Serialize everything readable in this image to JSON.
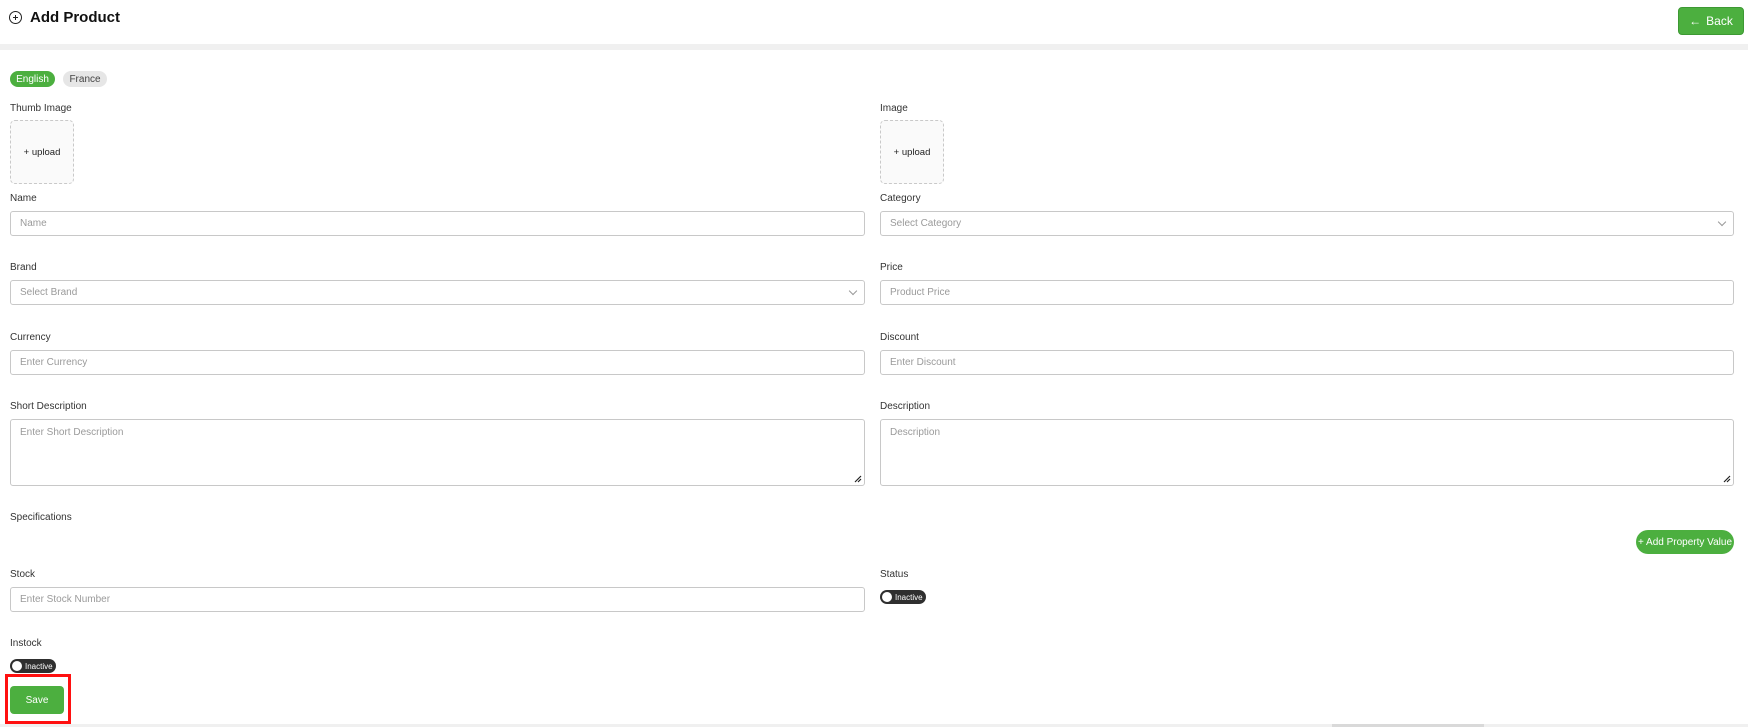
{
  "header": {
    "title": "Add Product",
    "back_label": "Back"
  },
  "languages": [
    "English",
    "France"
  ],
  "form": {
    "thumb_image": {
      "label": "Thumb Image",
      "upload": "+ upload"
    },
    "image": {
      "label": "Image",
      "upload": "+ upload"
    },
    "name": {
      "label": "Name",
      "placeholder": "Name"
    },
    "category": {
      "label": "Category",
      "placeholder": "Select Category"
    },
    "brand": {
      "label": "Brand",
      "placeholder": "Select Brand"
    },
    "price": {
      "label": "Price",
      "placeholder": "Product Price"
    },
    "currency": {
      "label": "Currency",
      "placeholder": "Enter Currency"
    },
    "discount": {
      "label": "Discount",
      "placeholder": "Enter Discount"
    },
    "short_description": {
      "label": "Short Description",
      "placeholder": "Enter Short Description"
    },
    "description": {
      "label": "Description",
      "placeholder": "Description"
    },
    "specifications": {
      "label": "Specifications",
      "add_label": "+ Add Property Value"
    },
    "stock": {
      "label": "Stock",
      "placeholder": "Enter Stock Number"
    },
    "status": {
      "label": "Status",
      "toggle_text": "Inactive"
    },
    "instock": {
      "label": "Instock",
      "toggle_text": "Inactive"
    },
    "save_label": "Save"
  },
  "colors": {
    "accent": "#4caf3f",
    "highlight": "#ff1010",
    "toggle_off": "#2f2f2f"
  }
}
